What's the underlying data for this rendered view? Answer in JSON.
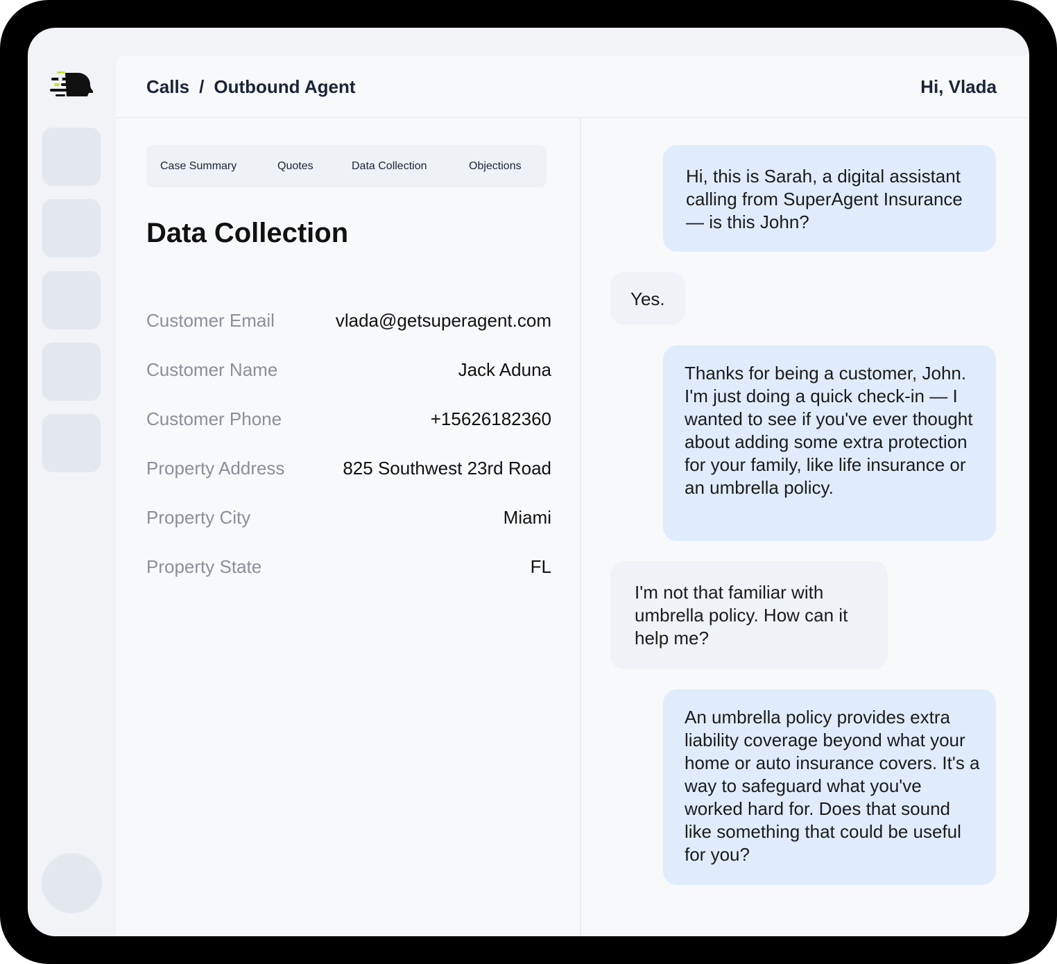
{
  "header": {
    "breadcrumb_root": "Calls",
    "breadcrumb_separator": "/",
    "breadcrumb_current": "Outbound Agent",
    "greeting": "Hi, Vlada"
  },
  "tabs": [
    {
      "label": "Case Summary"
    },
    {
      "label": "Quotes"
    },
    {
      "label": "Data Collection"
    },
    {
      "label": "Objections"
    }
  ],
  "section_title": "Data Collection",
  "fields": [
    {
      "label": "Customer Email",
      "value": "vlada@getsuperagent.com"
    },
    {
      "label": "Customer Name",
      "value": "Jack Aduna"
    },
    {
      "label": "Customer Phone",
      "value": "+15626182360"
    },
    {
      "label": "Property Address",
      "value": "825 Southwest 23rd Road"
    },
    {
      "label": "Property City",
      "value": "Miami"
    },
    {
      "label": "Property State",
      "value": "FL"
    }
  ],
  "messages": [
    {
      "role": "agent",
      "text": "Hi, this is Sarah, a digital assistant calling from SuperAgent Insurance — is this John?"
    },
    {
      "role": "user",
      "text": "Yes."
    },
    {
      "role": "agent",
      "text": "Thanks for being a customer, John. I'm just doing a quick check-in — I wanted to see if you've ever thought about adding some extra protection for your family, like life insurance or an umbrella policy."
    },
    {
      "role": "user",
      "text": "I'm not that familiar with umbrella policy. How can it help me?"
    },
    {
      "role": "agent",
      "text": "An umbrella policy provides extra liability coverage beyond what your home or auto insurance covers. It's a way to safeguard what you've worked hard for. Does that sound like something that could be useful for you?"
    }
  ],
  "colors": {
    "agent_bubble": "#e0ecfc",
    "user_bubble": "#eff2f6",
    "logo_accent": "#c6e13a",
    "heading_text": "#1a2438"
  }
}
